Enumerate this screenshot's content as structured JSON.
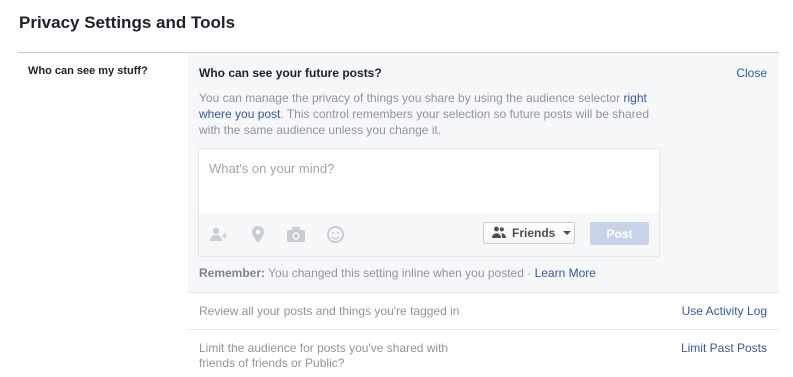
{
  "page": {
    "title": "Privacy Settings and Tools"
  },
  "section": {
    "label": "Who can see my stuff?"
  },
  "expanded": {
    "title": "Who can see your future posts?",
    "close_label": "Close",
    "description_before": "You can manage the privacy of things you share by using the audience selector ",
    "description_link": "right where you post",
    "description_after": ". This control remembers your selection so future posts will be shared with the same audience unless you change it.",
    "composer": {
      "placeholder": "What's on your mind?",
      "icons": [
        "tag-friends-icon",
        "location-icon",
        "camera-icon",
        "emoji-icon"
      ],
      "audience_label": "Friends",
      "post_label": "Post"
    },
    "remember_bold": "Remember:",
    "remember_text": " You changed this setting inline when you posted · ",
    "learn_more": "Learn More"
  },
  "rows": [
    {
      "text": "Review all your posts and things you're tagged in",
      "link": "Use Activity Log"
    },
    {
      "text": "Limit the audience for posts you've shared with friends of friends or Public?",
      "link": "Limit Past Posts"
    }
  ],
  "colors": {
    "link": "#365899",
    "muted_text": "#90949c",
    "panel_bg": "#f6f7f9",
    "post_button_disabled": "#c8d3ea"
  }
}
